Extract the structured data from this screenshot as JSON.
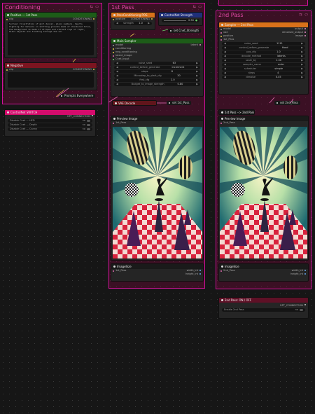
{
  "groups": [
    {
      "id": "conditioning",
      "title": "Conditioning",
      "icons": "⇆ ▭"
    },
    {
      "id": "first",
      "title": "1st Pass",
      "icons": "⇆ ▭"
    },
    {
      "id": "second",
      "title": "2nd Pass",
      "icons": "⇆ ▭"
    }
  ],
  "positive": {
    "title": "Positive — 1st Pass",
    "input": "clip",
    "output": "CONDITIONING",
    "text": "Surreal illustration of girl dancer, plain numbers, hearts fighting for balance on shifting grounds made of checkered tiles, the background is made of stripes and vibrant rays of light, Giant objects are floating through the air"
  },
  "negative": {
    "title": "Negative",
    "input": "clip",
    "output": "CONDITIONING"
  },
  "prompts_everywhere": "Prompts Everywhere",
  "controlnet_switch": {
    "title": "ControlNet SWITCH",
    "output": "OPT_CONNECTION",
    "rows": [
      {
        "label": "Disable Cnet — HED",
        "value": "no"
      },
      {
        "label": "Disable Cnet — Depth",
        "value": "no"
      },
      {
        "label": "Disable Cnet — Canny",
        "value": "no"
      }
    ]
  },
  "pass_positive": {
    "title": "PassConditioning POS",
    "input": "positive",
    "output": "CONDITIONING",
    "widget": "strength",
    "value": "1.0"
  },
  "cnet_strength": {
    "title": "ControlNet Strength",
    "value": "0.50"
  },
  "set_cnet_strength": "set Cnet_Strength",
  "ksampler1": {
    "title": "Main Sampler",
    "inputs": [
      "model",
      "conditioning",
      "neg_conditioning",
      "latent_image",
      "Cnet_Input"
    ],
    "output": "latent",
    "widgets": [
      {
        "label": "noise_seed",
        "value": "63"
      },
      {
        "label": "control_before_generate",
        "value": "increment"
      },
      {
        "label": "steps",
        "value": "8"
      },
      {
        "label": "Microstep_to_start_cfg",
        "value": "30"
      },
      {
        "label": "first_cfg",
        "value": "2.0"
      },
      {
        "label": "Budget_to_image_strength",
        "value": "0.80"
      }
    ]
  },
  "vae_decode": "VAE Decode",
  "set_1st_pass": "set 1st_Pass",
  "preview1": {
    "title": "Preview Image",
    "input": "1st_Pass"
  },
  "imagesize1": {
    "title": "ImageSize",
    "input": "1st_Pass",
    "outputs": [
      "width_int",
      "height_int"
    ]
  },
  "sampler2": {
    "title": "Sampler — 2nd Pass",
    "inputs": [
      "model",
      "vae",
      "positive",
      "1st_Pass"
    ],
    "outputs": [
      "output",
      "denoised_output",
      "image"
    ],
    "widgets": [
      {
        "label": "noise_seed",
        "value": "1111"
      },
      {
        "label": "control_before_generate",
        "value": "fixed"
      },
      {
        "label": "pos_cfg",
        "value": "1.0"
      },
      {
        "label": "decode_method",
        "value": "latents"
      },
      {
        "label": "scale_by",
        "value": "1.50"
      },
      {
        "label": "sampler_name",
        "value": "euler"
      },
      {
        "label": "scheduler",
        "value": "simple"
      },
      {
        "label": "steps",
        "value": "4"
      },
      {
        "label": "denoise",
        "value": "0.45"
      }
    ]
  },
  "set_2nd_pass": "set 2nd_Pass",
  "pass_switch": {
    "title": "1st Pass --> 2nd Pass"
  },
  "preview2": {
    "title": "Preview Image",
    "input": "2nd_Pass"
  },
  "imagesize2": {
    "title": "ImageSize",
    "input": "2nd_Pass",
    "outputs": [
      "width_int",
      "height_int"
    ]
  },
  "second_onoff": {
    "title": "2nd Pass: ON / OFF",
    "output": "OPT_CONNECTION",
    "row_label": "Enable 2nd Pass",
    "row_value": "no"
  }
}
